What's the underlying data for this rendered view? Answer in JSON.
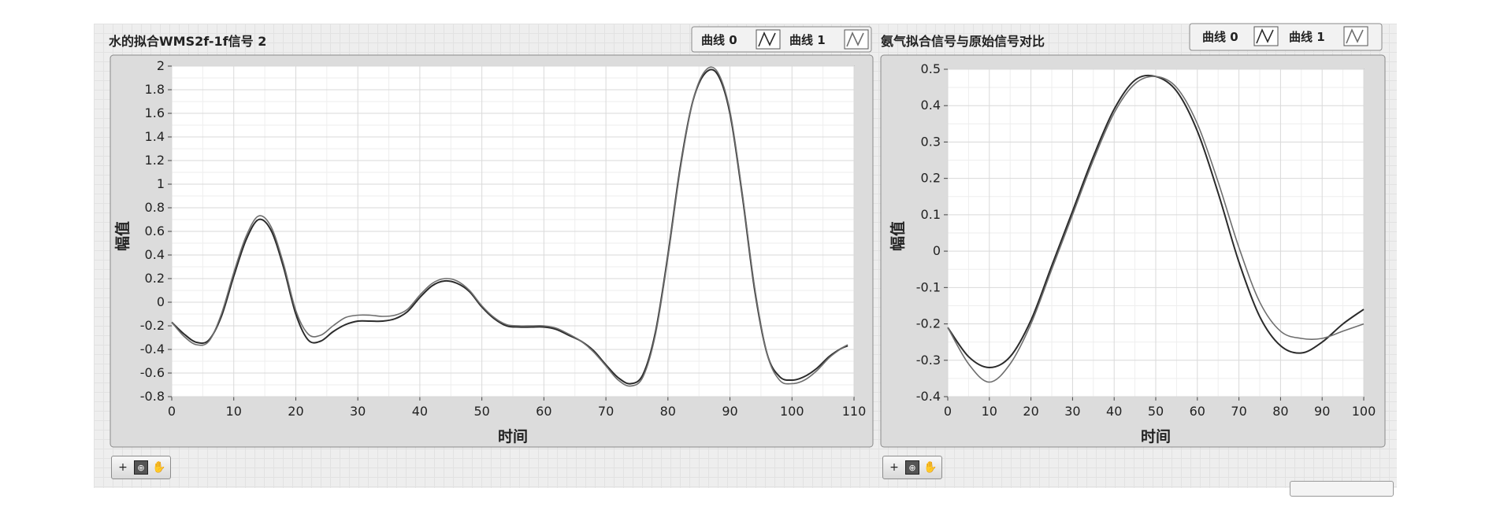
{
  "chart_data": [
    {
      "type": "line",
      "title": "水的拟合WMS2f-1f信号 2",
      "xlabel": "时间",
      "ylabel": "幅值",
      "xlim": [
        0,
        110
      ],
      "ylim": [
        -0.8,
        2
      ],
      "xticks": [
        0,
        10,
        20,
        30,
        40,
        50,
        60,
        70,
        80,
        90,
        100,
        110
      ],
      "yticks": [
        -0.8,
        -0.6,
        -0.4,
        -0.2,
        0,
        0.2,
        0.4,
        0.6,
        0.8,
        1,
        1.2,
        1.4,
        1.6,
        1.8,
        2
      ],
      "ytick_labels": [
        "-0.8",
        "-0.6",
        "-0.4",
        "-0.2",
        "0",
        "0.2",
        "0.4",
        "0.6",
        "0.8",
        "1",
        "1.2",
        "1.4",
        "1.6",
        "1.8",
        "2"
      ],
      "grid": true,
      "legend_position": "top-right",
      "series": [
        {
          "name": "曲线 0",
          "color": "#2b2b2b",
          "x": [
            0,
            2,
            4,
            6,
            8,
            10,
            12,
            14,
            16,
            18,
            20,
            22,
            24,
            26,
            28,
            30,
            32,
            34,
            36,
            38,
            40,
            42,
            44,
            46,
            48,
            50,
            52,
            54,
            56,
            58,
            60,
            62,
            64,
            66,
            68,
            70,
            72,
            74,
            76,
            78,
            80,
            82,
            84,
            86,
            88,
            90,
            92,
            94,
            96,
            98,
            100,
            102,
            104,
            106,
            108,
            109
          ],
          "y": [
            -0.17,
            -0.27,
            -0.34,
            -0.32,
            -0.12,
            0.22,
            0.53,
            0.7,
            0.61,
            0.3,
            -0.1,
            -0.32,
            -0.33,
            -0.25,
            -0.19,
            -0.16,
            -0.16,
            -0.16,
            -0.14,
            -0.08,
            0.04,
            0.14,
            0.18,
            0.16,
            0.09,
            -0.04,
            -0.14,
            -0.2,
            -0.21,
            -0.21,
            -0.21,
            -0.23,
            -0.28,
            -0.33,
            -0.41,
            -0.53,
            -0.64,
            -0.69,
            -0.61,
            -0.25,
            0.4,
            1.15,
            1.7,
            1.94,
            1.93,
            1.6,
            0.9,
            0.1,
            -0.44,
            -0.63,
            -0.66,
            -0.63,
            -0.56,
            -0.46,
            -0.39,
            -0.37
          ]
        },
        {
          "name": "曲线 1",
          "color": "#6e6e6e",
          "x": [
            0,
            2,
            4,
            6,
            8,
            10,
            12,
            14,
            16,
            18,
            20,
            22,
            24,
            26,
            28,
            30,
            32,
            34,
            36,
            38,
            40,
            42,
            44,
            46,
            48,
            50,
            52,
            54,
            56,
            58,
            60,
            62,
            64,
            66,
            68,
            70,
            72,
            74,
            76,
            78,
            80,
            82,
            84,
            86,
            88,
            90,
            92,
            94,
            96,
            98,
            100,
            102,
            104,
            106,
            108,
            109
          ],
          "y": [
            -0.17,
            -0.29,
            -0.36,
            -0.33,
            -0.1,
            0.25,
            0.56,
            0.73,
            0.64,
            0.33,
            -0.07,
            -0.27,
            -0.28,
            -0.2,
            -0.13,
            -0.11,
            -0.11,
            -0.12,
            -0.11,
            -0.06,
            0.06,
            0.16,
            0.2,
            0.18,
            0.1,
            -0.03,
            -0.13,
            -0.19,
            -0.2,
            -0.2,
            -0.2,
            -0.22,
            -0.27,
            -0.33,
            -0.42,
            -0.54,
            -0.66,
            -0.71,
            -0.63,
            -0.27,
            0.38,
            1.13,
            1.7,
            1.96,
            1.95,
            1.62,
            0.92,
            0.12,
            -0.44,
            -0.66,
            -0.69,
            -0.66,
            -0.58,
            -0.47,
            -0.39,
            -0.36
          ]
        }
      ]
    },
    {
      "type": "line",
      "title": "氨气拟合信号与原始信号对比",
      "xlabel": "时间",
      "ylabel": "幅值",
      "xlim": [
        0,
        100
      ],
      "ylim": [
        -0.4,
        0.5
      ],
      "xticks": [
        0,
        10,
        20,
        30,
        40,
        50,
        60,
        70,
        80,
        90,
        100
      ],
      "yticks": [
        -0.4,
        -0.3,
        -0.2,
        -0.1,
        0,
        0.1,
        0.2,
        0.3,
        0.4,
        0.5
      ],
      "ytick_labels": [
        "-0.4",
        "-0.3",
        "-0.2",
        "-0.1",
        "0",
        "0.1",
        "0.2",
        "0.3",
        "0.4",
        "0.5"
      ],
      "grid": true,
      "legend_position": "top-right",
      "series": [
        {
          "name": "曲线 0",
          "color": "#2b2b2b",
          "x": [
            0,
            5,
            10,
            15,
            20,
            25,
            30,
            35,
            40,
            45,
            50,
            55,
            60,
            65,
            70,
            75,
            80,
            85,
            90,
            95,
            100
          ],
          "y": [
            -0.21,
            -0.29,
            -0.32,
            -0.29,
            -0.19,
            -0.04,
            0.11,
            0.26,
            0.39,
            0.47,
            0.48,
            0.44,
            0.33,
            0.16,
            -0.03,
            -0.18,
            -0.26,
            -0.28,
            -0.25,
            -0.2,
            -0.16
          ]
        },
        {
          "name": "曲线 1",
          "color": "#6e6e6e",
          "x": [
            0,
            5,
            10,
            15,
            20,
            25,
            30,
            35,
            40,
            45,
            50,
            55,
            60,
            65,
            70,
            75,
            80,
            85,
            90,
            95,
            100
          ],
          "y": [
            -0.21,
            -0.31,
            -0.36,
            -0.31,
            -0.2,
            -0.05,
            0.1,
            0.25,
            0.38,
            0.46,
            0.48,
            0.45,
            0.35,
            0.19,
            0.01,
            -0.14,
            -0.22,
            -0.24,
            -0.24,
            -0.22,
            -0.2
          ]
        }
      ]
    }
  ]
}
